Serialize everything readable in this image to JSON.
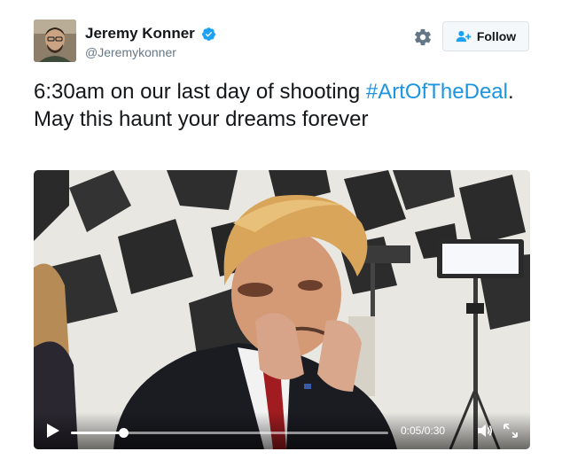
{
  "author": {
    "display_name": "Jeremy Konner",
    "handle": "@Jeremykonner",
    "verified": true
  },
  "actions": {
    "follow_label": "Follow"
  },
  "tweet": {
    "text_before": "6:30am on our last day of shooting ",
    "hashtag": "#ArtOfTheDeal",
    "text_after": ". May this haunt your dreams forever"
  },
  "video": {
    "current_time": "0:05",
    "separator": "/",
    "duration": "0:30",
    "progress_fraction": 0.165
  },
  "colors": {
    "hashtag": "#1b95e0",
    "verified": "#1da1f2",
    "follow_icon": "#1da1f2"
  }
}
